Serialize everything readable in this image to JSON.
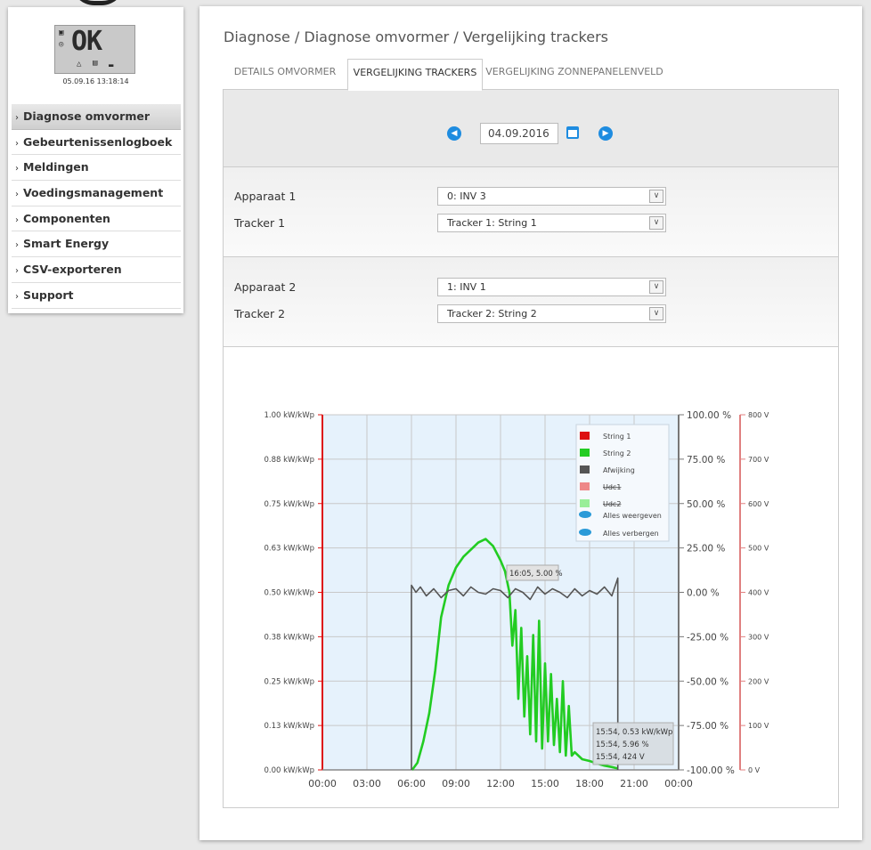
{
  "lcd": {
    "status": "OK",
    "datetime": "05.09.16 13:18:14"
  },
  "sidebar": {
    "items": [
      {
        "label": "Diagnose omvormer",
        "active": true
      },
      {
        "label": "Gebeurtenissenlogboek",
        "active": false
      },
      {
        "label": "Meldingen",
        "active": false
      },
      {
        "label": "Voedingsmanagement",
        "active": false
      },
      {
        "label": "Componenten",
        "active": false
      },
      {
        "label": "Smart Energy",
        "active": false
      },
      {
        "label": "CSV-exporteren",
        "active": false
      },
      {
        "label": "Support",
        "active": false
      }
    ]
  },
  "breadcrumb": "Diagnose / Diagnose omvormer / Vergelijking trackers",
  "tabs": [
    {
      "label": "DETAILS OMVORMER",
      "active": false
    },
    {
      "label": "VERGELIJKING TRACKERS",
      "active": true
    },
    {
      "label": "VERGELIJKING ZONNEPANELENVELD",
      "active": false
    }
  ],
  "date": {
    "value": "04.09.2016"
  },
  "device1": {
    "apparaat_label": "Apparaat 1",
    "apparaat_value": "0: INV 3",
    "tracker_label": "Tracker 1",
    "tracker_value": "Tracker 1: String 1"
  },
  "device2": {
    "apparaat_label": "Apparaat 2",
    "apparaat_value": "1: INV 1",
    "tracker_label": "Tracker 2",
    "tracker_value": "Tracker 2: String 2"
  },
  "colors": {
    "accent": "#1e8ce0",
    "string1": "#dd1111",
    "string2": "#22cc22",
    "afwijking": "#555555",
    "udc1": "#ee8888",
    "udc2": "#99ee99",
    "plot_bg": "#e6f2fc"
  },
  "legend": {
    "items": [
      {
        "label": "String 1",
        "color": "#dd1111"
      },
      {
        "label": "String 2",
        "color": "#22cc22"
      },
      {
        "label": "Afwijking",
        "color": "#555555"
      },
      {
        "label": "Udc1",
        "color": "#ee8888"
      },
      {
        "label": "Udc2",
        "color": "#99ee99"
      }
    ],
    "show_all": "Alles weergeven",
    "hide_all": "Alles verbergen"
  },
  "tooltips": {
    "deviation": "16:05, 5.00 %",
    "power": "15:54, 0.53 kW/kWp",
    "percent": "15:54, 5.96 %",
    "voltage": "15:54, 424 V"
  },
  "chart_data": {
    "type": "line",
    "x_ticks": [
      "00:00",
      "03:00",
      "06:00",
      "09:00",
      "12:00",
      "15:00",
      "18:00",
      "21:00",
      "00:00"
    ],
    "y_left_ticks": [
      "0.00 kW/kWp",
      "0.13 kW/kWp",
      "0.25 kW/kWp",
      "0.38 kW/kWp",
      "0.50 kW/kWp",
      "0.63 kW/kWp",
      "0.75 kW/kWp",
      "0.88 kW/kWp",
      "1.00 kW/kWp"
    ],
    "y_mid_ticks": [
      "-100.00 %",
      "-75.00 %",
      "-50.00 %",
      "-25.00 %",
      "0.00 %",
      "25.00 %",
      "50.00 %",
      "75.00 %",
      "100.00 %"
    ],
    "y_right_ticks": [
      "0 V",
      "100 V",
      "200 V",
      "300 V",
      "400 V",
      "500 V",
      "600 V",
      "700 V",
      "800 V"
    ],
    "ylim_power": [
      0,
      1
    ],
    "ylim_percent": [
      -100,
      100
    ],
    "ylim_voltage": [
      0,
      800
    ],
    "xlim_hours": [
      0,
      24
    ],
    "grid": true,
    "legend_position": "top-right",
    "series": [
      {
        "name": "String 2",
        "axis": "kW/kWp",
        "x": [
          6.05,
          6.4,
          6.8,
          7.2,
          7.6,
          8.0,
          8.5,
          9.0,
          9.5,
          10.0,
          10.5,
          11.0,
          11.5,
          12.0,
          12.3,
          12.6,
          12.8,
          13.0,
          13.2,
          13.4,
          13.6,
          13.8,
          14.0,
          14.2,
          14.4,
          14.6,
          14.8,
          15.0,
          15.2,
          15.4,
          15.6,
          15.8,
          16.0,
          16.2,
          16.4,
          16.6,
          16.8,
          17.0,
          17.5,
          18.0,
          18.5,
          19.0,
          19.5,
          19.9
        ],
        "y": [
          0.0,
          0.02,
          0.08,
          0.16,
          0.28,
          0.43,
          0.52,
          0.57,
          0.6,
          0.62,
          0.64,
          0.65,
          0.63,
          0.59,
          0.56,
          0.5,
          0.35,
          0.45,
          0.2,
          0.4,
          0.15,
          0.32,
          0.1,
          0.38,
          0.08,
          0.42,
          0.06,
          0.3,
          0.08,
          0.27,
          0.07,
          0.2,
          0.05,
          0.25,
          0.04,
          0.18,
          0.04,
          0.05,
          0.03,
          0.025,
          0.018,
          0.012,
          0.008,
          0.004
        ]
      },
      {
        "name": "Afwijking",
        "axis": "%",
        "x": [
          6.0,
          6.0,
          6.3,
          6.6,
          7.0,
          7.5,
          8.0,
          8.5,
          9.0,
          9.5,
          10.0,
          10.5,
          11.0,
          11.5,
          12.0,
          12.5,
          13.0,
          13.5,
          14.0,
          14.5,
          15.0,
          15.5,
          16.0,
          16.5,
          17.0,
          17.5,
          18.0,
          18.5,
          19.0,
          19.5,
          19.9,
          19.9
        ],
        "y": [
          -100,
          4,
          0,
          3,
          -2,
          2,
          -3,
          1,
          2,
          -2,
          3,
          0,
          -1,
          2,
          1,
          -3,
          2,
          0,
          -4,
          3,
          -1,
          2,
          0,
          -3,
          2,
          -2,
          1,
          -1,
          3,
          -2,
          8,
          -100
        ]
      }
    ]
  }
}
